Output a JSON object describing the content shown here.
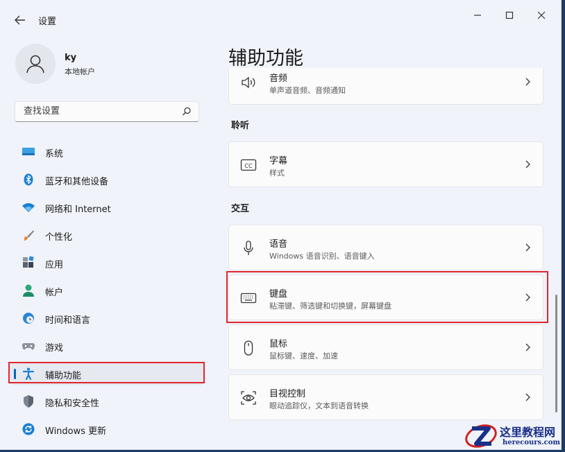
{
  "window": {
    "title": "设置"
  },
  "user": {
    "name": "ky",
    "account_type": "本地帐户"
  },
  "search": {
    "placeholder": "查找设置"
  },
  "sidebar": {
    "items": [
      {
        "label": "系统",
        "icon": "system-icon"
      },
      {
        "label": "蓝牙和其他设备",
        "icon": "bluetooth-icon"
      },
      {
        "label": "网络和 Internet",
        "icon": "wifi-icon"
      },
      {
        "label": "个性化",
        "icon": "brush-icon"
      },
      {
        "label": "应用",
        "icon": "apps-icon"
      },
      {
        "label": "帐户",
        "icon": "account-icon"
      },
      {
        "label": "时间和语言",
        "icon": "clock-globe-icon"
      },
      {
        "label": "游戏",
        "icon": "gamepad-icon"
      },
      {
        "label": "辅助功能",
        "icon": "accessibility-icon",
        "active": true
      },
      {
        "label": "隐私和安全性",
        "icon": "shield-icon"
      },
      {
        "label": "Windows 更新",
        "icon": "update-icon"
      }
    ]
  },
  "main": {
    "title": "辅助功能",
    "cards": {
      "audio": {
        "title": "音频",
        "subtitle": "单声道音频、音频通知"
      },
      "captions": {
        "title": "字幕",
        "subtitle": "样式"
      },
      "speech": {
        "title": "语音",
        "subtitle": "Windows 语音识别、语音键入"
      },
      "keyboard": {
        "title": "键盘",
        "subtitle": "粘滞键、筛选键和切换键，屏幕键盘"
      },
      "mouse": {
        "title": "鼠标",
        "subtitle": "鼠标键、速度、加速"
      },
      "eye": {
        "title": "目视控制",
        "subtitle": "眼动追踪仪，文本到语音转换"
      }
    },
    "sections": {
      "hearing": "聆听",
      "interaction": "交互"
    }
  },
  "watermark": {
    "cn": "这里教程网",
    "en": "herecours.com"
  },
  "colors": {
    "accent": "#0067c0",
    "highlight": "#e1252d"
  }
}
